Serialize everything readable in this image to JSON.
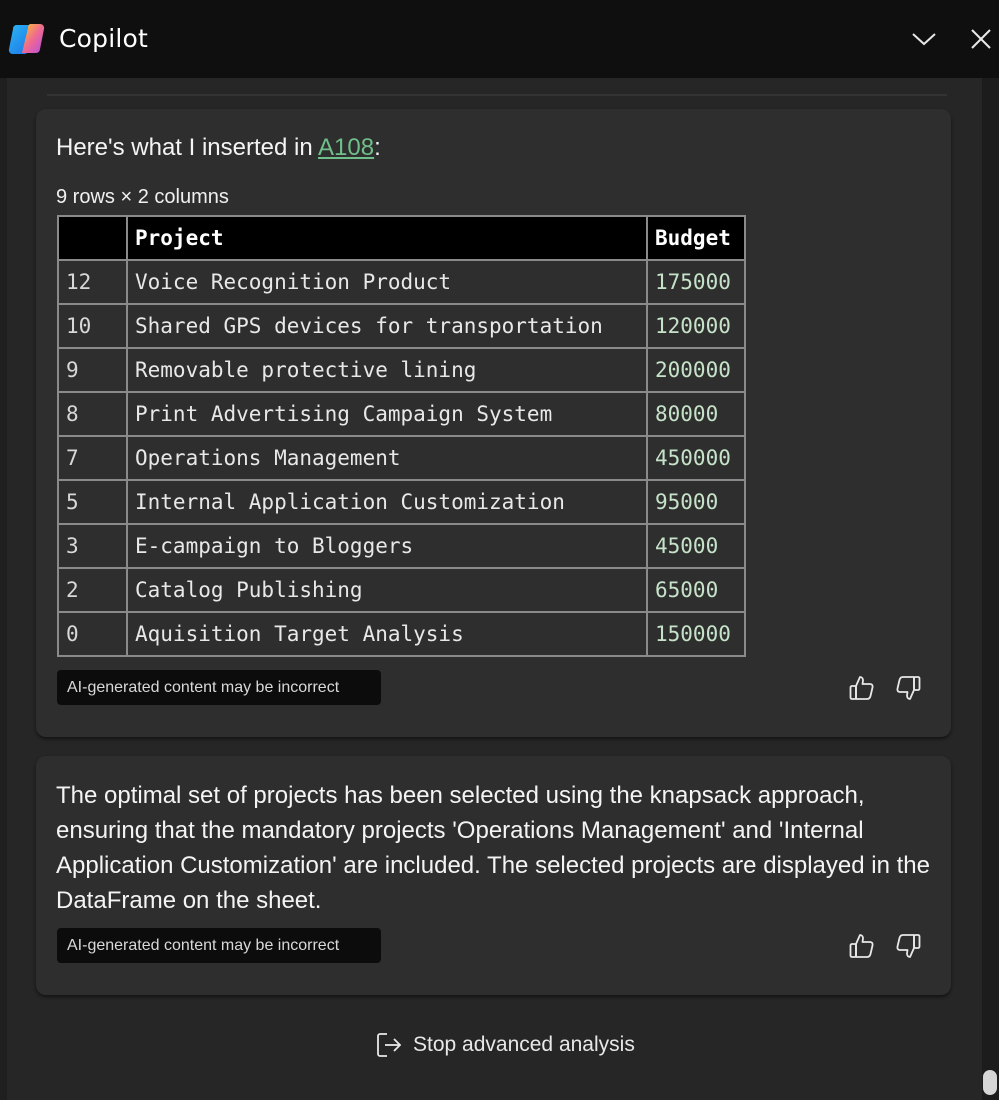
{
  "window": {
    "title": "Copilot",
    "icons": {
      "logo": "copilot-logo",
      "minimize": "chevron-down-icon",
      "close": "close-icon"
    }
  },
  "response1": {
    "intro_prefix": "Here's what I inserted in ",
    "cell_ref": "A108",
    "intro_suffix": ":",
    "dims": "9 rows × 2 columns",
    "table": {
      "headers": [
        "",
        "Project",
        "Budget"
      ],
      "rows": [
        {
          "index": "12",
          "project": "Voice Recognition Product",
          "budget": "175000"
        },
        {
          "index": "10",
          "project": "Shared GPS devices for transportation",
          "budget": "120000"
        },
        {
          "index": "9",
          "project": "Removable protective lining",
          "budget": "200000"
        },
        {
          "index": "8",
          "project": "Print Advertising Campaign System",
          "budget": "80000"
        },
        {
          "index": "7",
          "project": "Operations Management",
          "budget": "450000"
        },
        {
          "index": "5",
          "project": "Internal Application Customization",
          "budget": "95000"
        },
        {
          "index": "3",
          "project": "E-campaign to Bloggers",
          "budget": "45000"
        },
        {
          "index": "2",
          "project": "Catalog Publishing",
          "budget": "65000"
        },
        {
          "index": "0",
          "project": "Aquisition Target Analysis",
          "budget": "150000"
        }
      ]
    },
    "disclaimer": "AI-generated content may be incorrect"
  },
  "response2": {
    "message": "The optimal set of projects has been selected using the knapsack approach, ensuring that the mandatory projects 'Operations Management' and 'Internal Application Customization' are included. The selected projects are displayed in the DataFrame on the sheet.",
    "disclaimer": "AI-generated content may be incorrect"
  },
  "footer": {
    "stop_label": "Stop advanced analysis",
    "icon": "exit-icon"
  }
}
